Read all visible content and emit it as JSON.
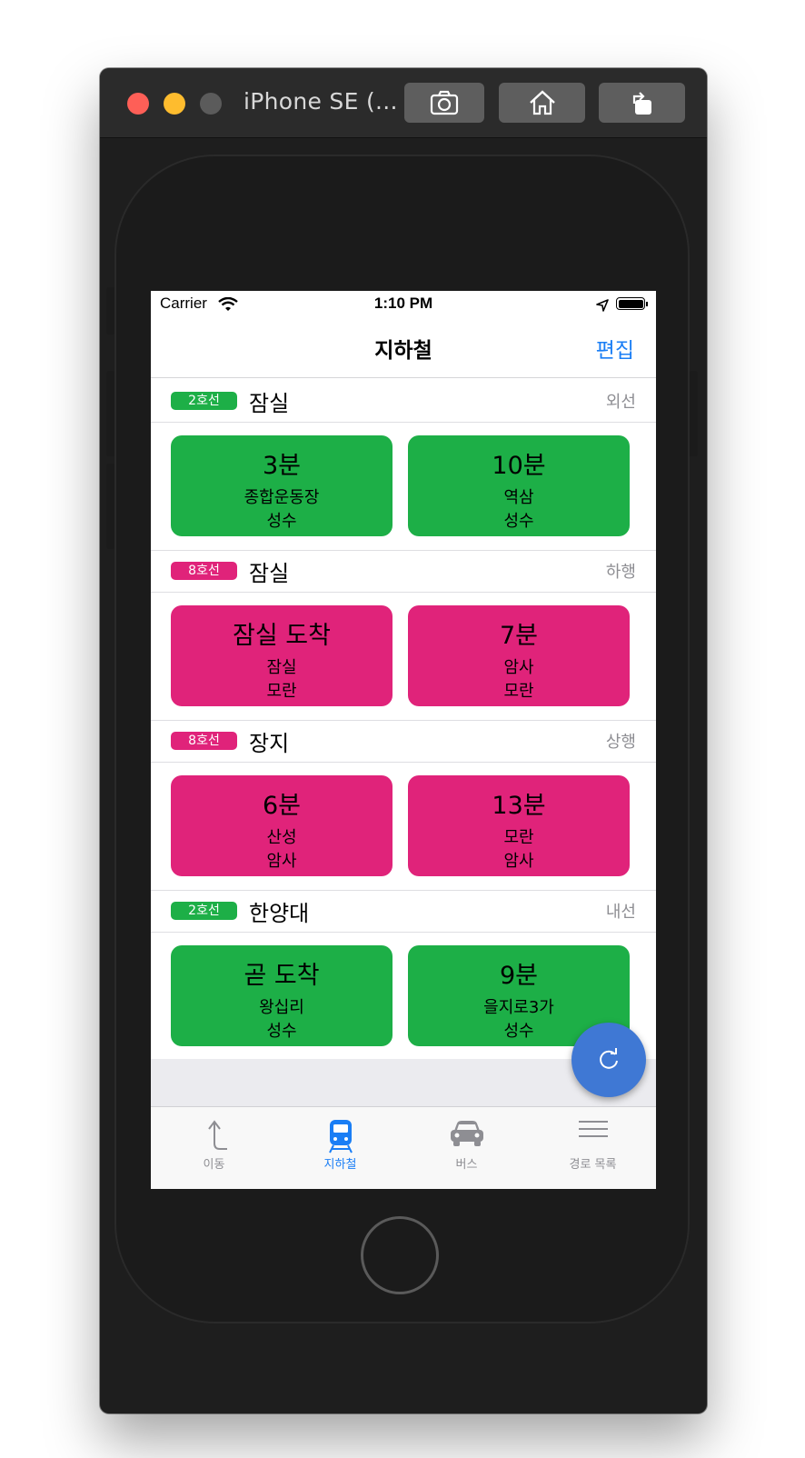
{
  "simulator": {
    "title": "iPhone SE (..."
  },
  "status_bar": {
    "carrier": "Carrier",
    "time": "1:10 PM"
  },
  "nav": {
    "title": "지하철",
    "edit": "편집"
  },
  "sections": [
    {
      "line": "2호선",
      "line_color": "#1daf47",
      "station": "잠실",
      "direction": "외선",
      "cards": [
        {
          "time": "3분",
          "destination": "종합운동장",
          "terminus": "성수"
        },
        {
          "time": "10분",
          "destination": "역삼",
          "terminus": "성수"
        }
      ]
    },
    {
      "line": "8호선",
      "line_color": "#e0237a",
      "station": "잠실",
      "direction": "하행",
      "cards": [
        {
          "time": "잠실 도착",
          "destination": "잠실",
          "terminus": "모란"
        },
        {
          "time": "7분",
          "destination": "암사",
          "terminus": "모란"
        }
      ]
    },
    {
      "line": "8호선",
      "line_color": "#e0237a",
      "station": "장지",
      "direction": "상행",
      "cards": [
        {
          "time": "6분",
          "destination": "산성",
          "terminus": "암사"
        },
        {
          "time": "13분",
          "destination": "모란",
          "terminus": "암사"
        }
      ]
    },
    {
      "line": "2호선",
      "line_color": "#1daf47",
      "station": "한양대",
      "direction": "내선",
      "cards": [
        {
          "time": "곧 도착",
          "destination": "왕십리",
          "terminus": "성수"
        },
        {
          "time": "9분",
          "destination": "을지로3가",
          "terminus": "성수"
        }
      ]
    }
  ],
  "tabs": [
    {
      "label": "이동",
      "icon": "turn-up-arrow-icon",
      "active": false
    },
    {
      "label": "지하철",
      "icon": "subway-train-icon",
      "active": true
    },
    {
      "label": "버스",
      "icon": "car-icon",
      "active": false
    },
    {
      "label": "경로 목록",
      "icon": "list-lines-icon",
      "active": false
    }
  ],
  "colors": {
    "accent": "#1a7ef5",
    "fab": "#3f78d4"
  }
}
